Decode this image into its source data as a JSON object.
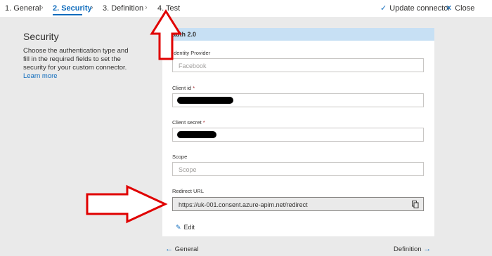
{
  "wizard": {
    "steps": [
      {
        "label": "1. General"
      },
      {
        "label": "2. Security"
      },
      {
        "label": "3. Definition"
      },
      {
        "label": "4. Test"
      }
    ],
    "update_label": "Update connector",
    "close_label": "Close"
  },
  "section": {
    "title": "Security",
    "description": "Choose the authentication type and fill in the required fields to set the security for your custom connector.",
    "learn_more": "Learn more"
  },
  "card": {
    "header": "auth 2.0",
    "identity_provider": {
      "label": "Identity Provider",
      "value": "Facebook"
    },
    "client_id": {
      "label": "Client id",
      "required": "*"
    },
    "client_secret": {
      "label": "Client secret",
      "required": "*"
    },
    "scope": {
      "label": "Scope",
      "placeholder": "Scope"
    },
    "redirect_url": {
      "label": "Redirect URL",
      "value": "https://uk-001.consent.azure-apim.net/redirect"
    },
    "edit_label": "Edit"
  },
  "footer": {
    "prev_label": "General",
    "next_label": "Definition"
  },
  "colors": {
    "accent": "#0f6cbd",
    "card_header": "#c7e0f4",
    "annotation": "#e00000"
  }
}
